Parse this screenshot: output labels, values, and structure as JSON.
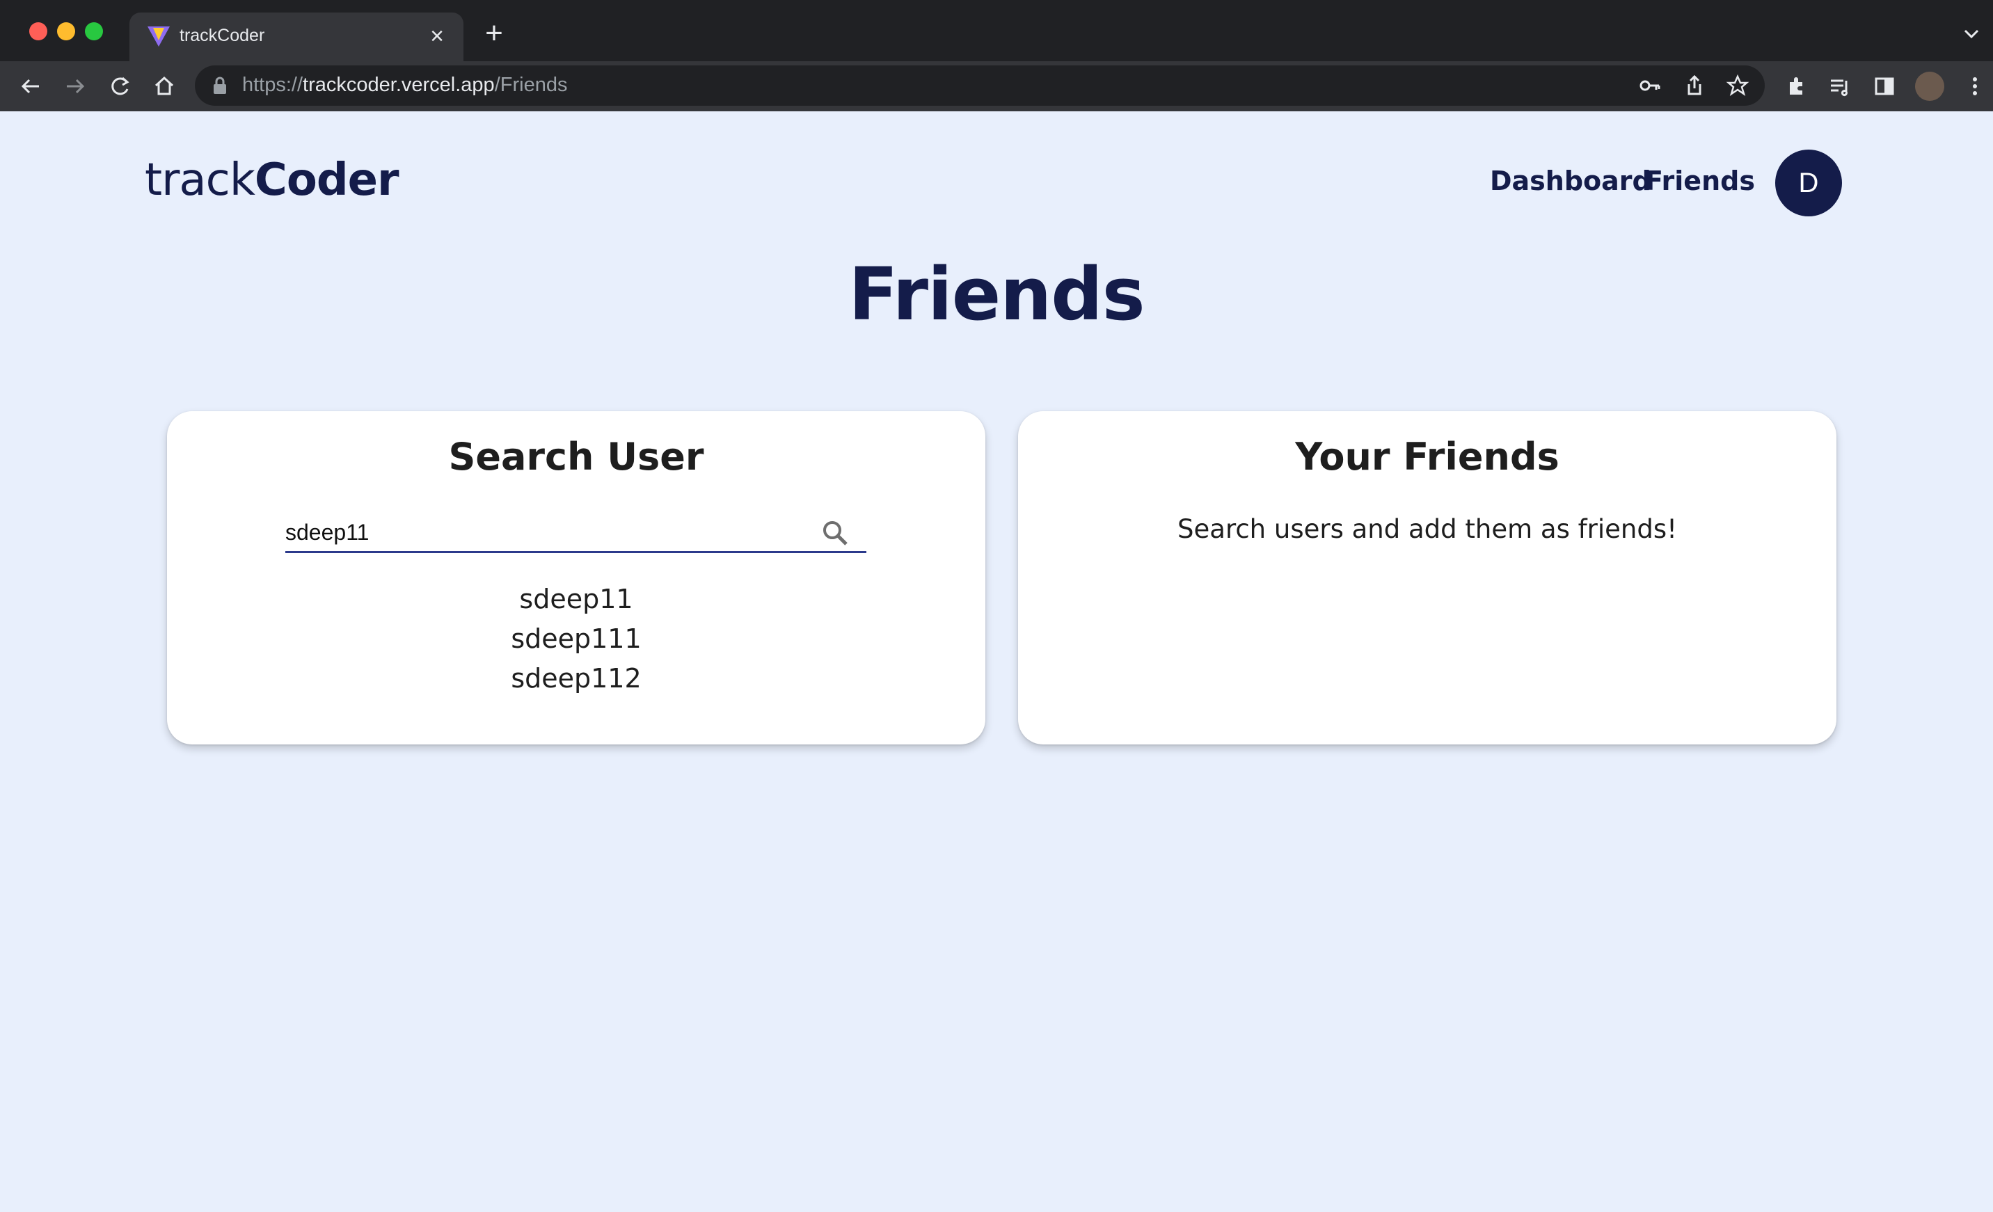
{
  "browser": {
    "tab_title": "trackCoder",
    "url_scheme": "https://",
    "url_host": "trackcoder.vercel.app",
    "url_path": "/Friends"
  },
  "header": {
    "logo_light": "track",
    "logo_bold": "Coder",
    "nav": [
      "Dashboard",
      "Friends"
    ],
    "avatar_initial": "D"
  },
  "page": {
    "title": "Friends"
  },
  "search_card": {
    "title": "Search User",
    "input_value": "sdeep11",
    "results": [
      "sdeep11",
      "sdeep111",
      "sdeep112"
    ]
  },
  "friends_card": {
    "title": "Your Friends",
    "empty_message": "Search users and add them as friends!"
  },
  "colors": {
    "background": "#e8effc",
    "brand_navy": "#141c4a",
    "input_underline": "#2c3a8c"
  }
}
